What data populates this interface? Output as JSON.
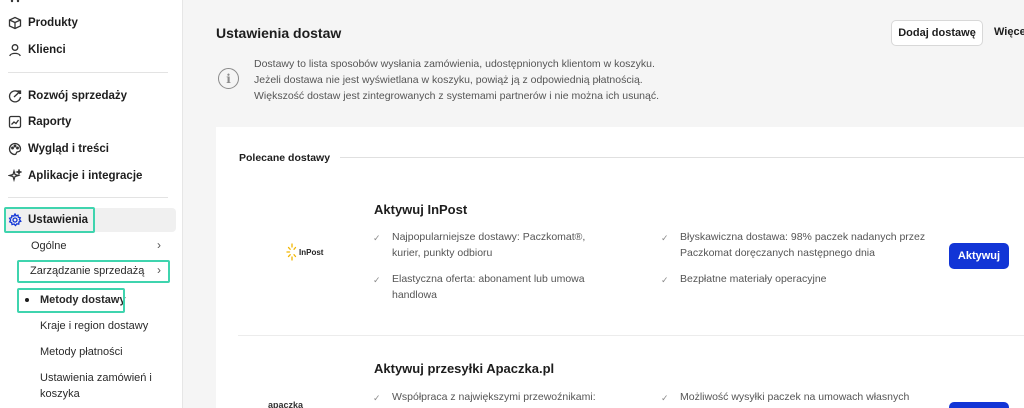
{
  "sidebar": {
    "items": [
      {
        "label": "Produkty",
        "icon": "box-icon"
      },
      {
        "label": "Klienci",
        "icon": "user-icon"
      },
      {
        "label": "Rozwój sprzedaży",
        "icon": "growth-icon"
      },
      {
        "label": "Raporty",
        "icon": "chart-icon"
      },
      {
        "label": "Wygląd i treści",
        "icon": "palette-icon"
      },
      {
        "label": "Aplikacje i integracje",
        "icon": "sparkle-icon"
      },
      {
        "label": "Ustawienia",
        "icon": "gear-icon"
      }
    ],
    "sub": {
      "ogolne": "Ogólne",
      "zarzadzanie": "Zarządzanie sprzedażą",
      "metody_dostawy": "Metody dostawy",
      "kraje": "Kraje i region dostawy",
      "platnosci": "Metody płatności",
      "zamowienia_1": "Ustawienia zamówień i",
      "zamowienia_2": "koszyka"
    }
  },
  "header": {
    "title": "Ustawienia dostaw",
    "add_button": "Dodaj dostawę",
    "more_button": "Więce"
  },
  "info": {
    "line1": "Dostawy to lista sposobów wysłania zamówienia, udostępnionych klientom w koszyku.",
    "line2": "Jeżeli dostawa nie jest wyświetlana w koszyku, powiąż ją z odpowiednią płatnością.",
    "line3": "Większość dostaw jest zintegrowanych z systemami partnerów i nie można ich usunąć."
  },
  "section": {
    "title": "Polecane dostawy"
  },
  "cards": [
    {
      "logo_text": "InPost",
      "title": "Aktywuj InPost",
      "features_left": [
        [
          "Najpopularniejsze dostawy: Paczkomat®,",
          "kurier, punkty odbioru"
        ],
        [
          "Elastyczna oferta: abonament lub umowa",
          "handlowa"
        ]
      ],
      "features_right": [
        [
          "Błyskawiczna dostawa: 98% paczek nadanych przez",
          "Paczkomat doręczanych następnego dnia"
        ],
        [
          "Bezpłatne materiały operacyjne"
        ]
      ],
      "button": "Aktywuj"
    },
    {
      "logo_text": "apaczka",
      "title": "Aktywuj przesyłki Apaczka.pl",
      "features_left": [
        [
          "Współpraca z największymi przewoźnikami:"
        ]
      ],
      "features_right": [
        [
          "Możliwość wysyłki paczek na umowach własnych"
        ]
      ]
    }
  ],
  "colors": {
    "accent": "#1235d6",
    "highlight": "#3fd4ae"
  }
}
